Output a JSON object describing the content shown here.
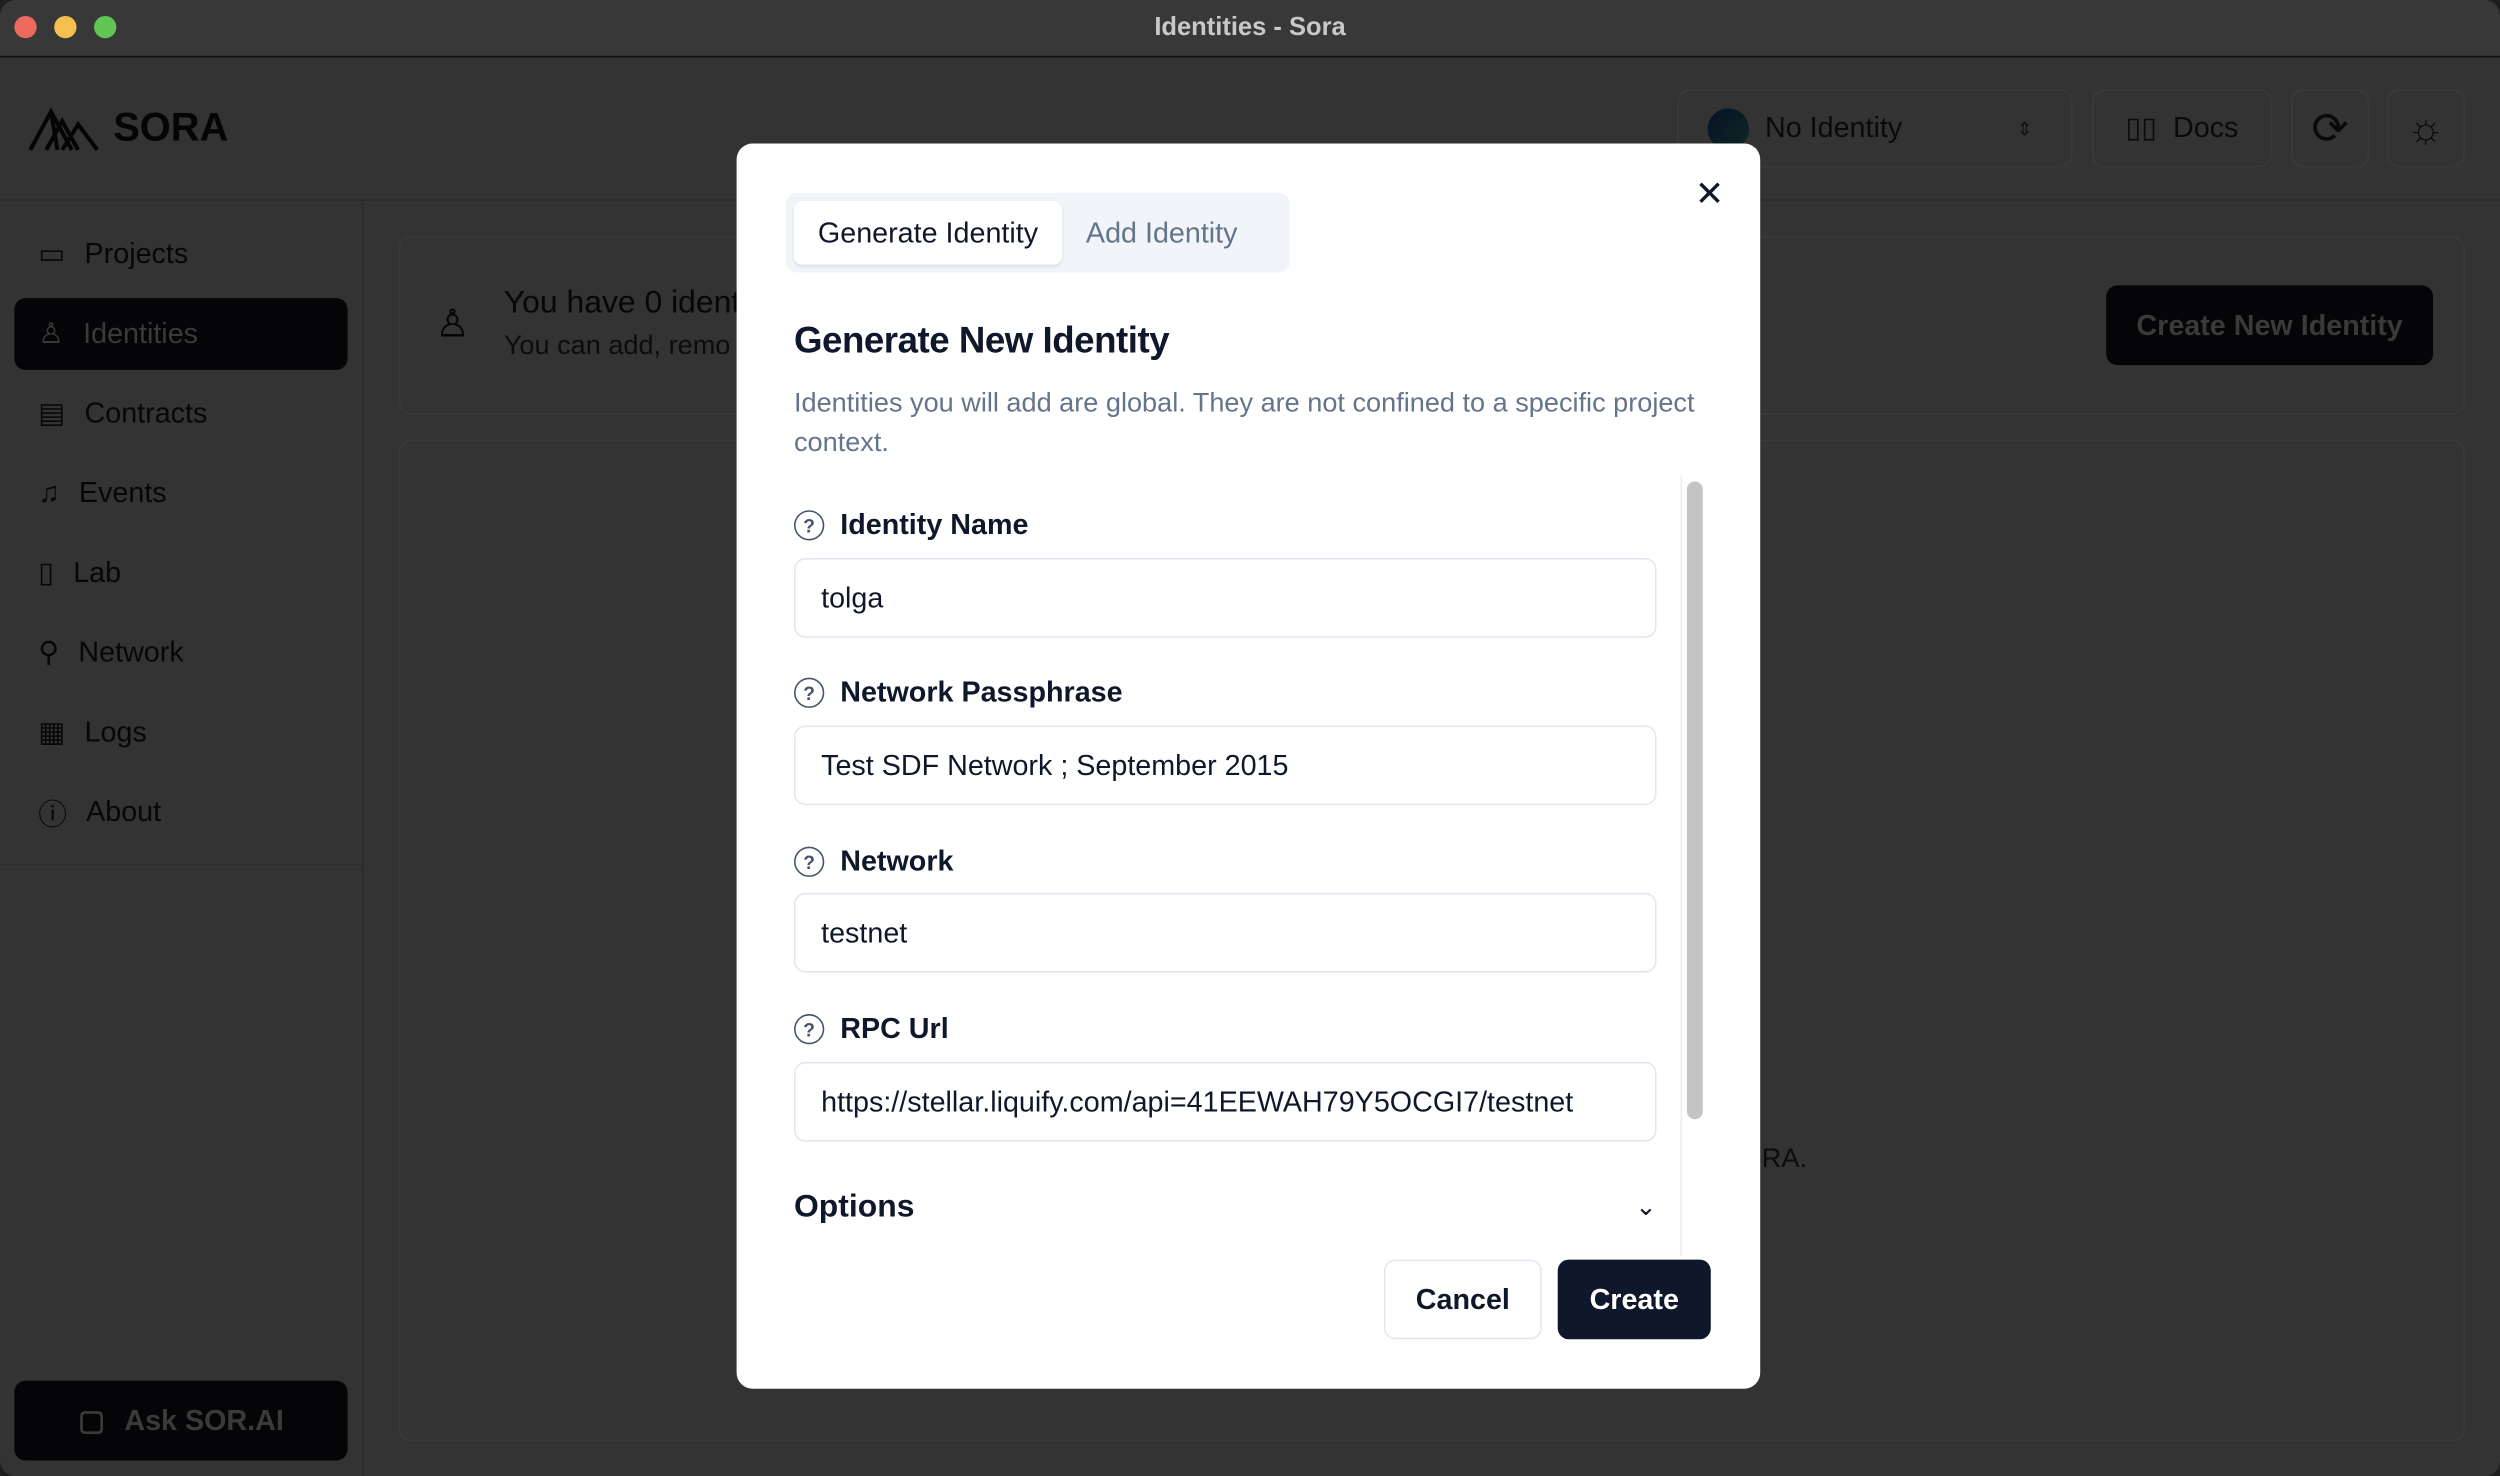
{
  "window": {
    "title": "Identities - Sora",
    "lights": [
      "#ec6a5e",
      "#f4bf4f",
      "#61c554"
    ]
  },
  "header": {
    "logo": "SORA",
    "identity_select": "No Identity",
    "docs": "Docs"
  },
  "sidebar": {
    "items": [
      {
        "label": "Projects",
        "icon": "folder-icon"
      },
      {
        "label": "Identities",
        "icon": "user-icon",
        "active": true
      },
      {
        "label": "Contracts",
        "icon": "file-icon"
      },
      {
        "label": "Events",
        "icon": "bell-icon"
      },
      {
        "label": "Lab",
        "icon": "flask-icon"
      },
      {
        "label": "Network",
        "icon": "network-icon"
      },
      {
        "label": "Logs",
        "icon": "logs-icon"
      },
      {
        "label": "About",
        "icon": "info-icon"
      }
    ],
    "ask": "Ask SOR.AI"
  },
  "main": {
    "heading": "You have 0 ident",
    "sub": "You can add, remo",
    "create_button": "Create New Identity",
    "empty_tail": "RA."
  },
  "modal": {
    "tabs": [
      "Generate Identity",
      "Add Identity"
    ],
    "title": "Generate New Identity",
    "description": "Identities you will add are global. They are not confined to a specific project context.",
    "fields": [
      {
        "label": "Identity Name",
        "value": "tolga"
      },
      {
        "label": "Network Passphrase",
        "value": "Test SDF Network ; September 2015"
      },
      {
        "label": "Network",
        "value": "testnet"
      },
      {
        "label": "RPC Url",
        "value": "https://stellar.liquify.com/api=41EEWAH79Y5OCGI7/testnet"
      }
    ],
    "options": "Options",
    "cancel": "Cancel",
    "create": "Create"
  },
  "colors": {
    "primary": "#0f172a",
    "muted": "#64748b"
  }
}
